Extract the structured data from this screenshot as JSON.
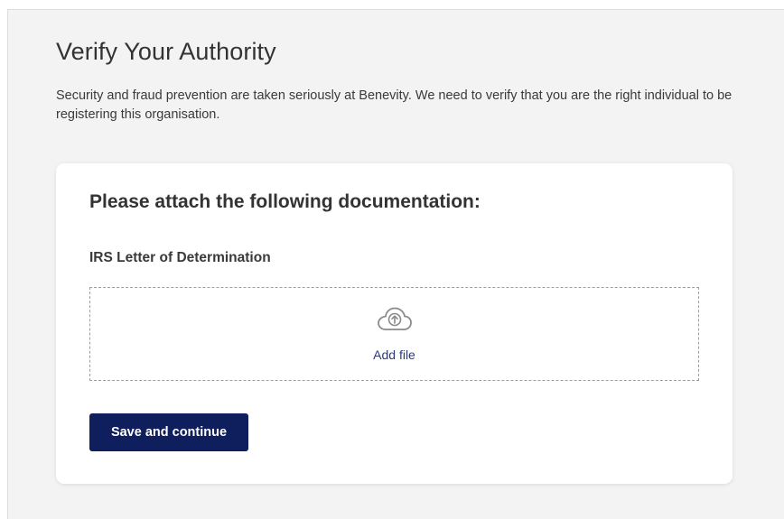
{
  "page": {
    "title": "Verify Your Authority",
    "intro": "Security and fraud prevention are taken seriously at Benevity. We need to verify that you are the right individual to be registering this organisation."
  },
  "card": {
    "heading": "Please attach the following documentation:",
    "document_label": "IRS Letter of Determination",
    "upload": {
      "icon": "cloud-upload-icon",
      "link_label": "Add file"
    },
    "save_button_label": "Save and continue"
  },
  "colors": {
    "page_background": "#f3f3f3",
    "card_background": "#ffffff",
    "primary_button": "#0f1f5e",
    "link": "#2b3a78"
  }
}
